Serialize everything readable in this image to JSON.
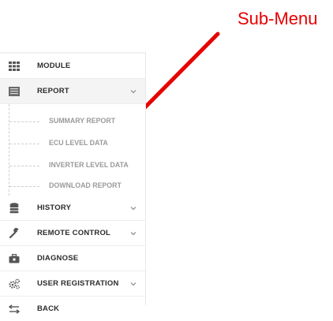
{
  "annotation": {
    "label": "Sub-Menu",
    "color": "#e60000"
  },
  "sidebar": {
    "items_top": [
      {
        "label": "MODULE",
        "icon": "grid-icon"
      },
      {
        "label": "REPORT",
        "icon": "report-icon",
        "expanded": true
      }
    ],
    "submenu": [
      {
        "label": "SUMMARY REPORT"
      },
      {
        "label": "ECU LEVEL DATA"
      },
      {
        "label": "INVERTER LEVEL DATA"
      },
      {
        "label": "DOWNLOAD REPORT"
      }
    ],
    "items_bottom": [
      {
        "label": "HISTORY",
        "icon": "database-icon",
        "has_chevron": true
      },
      {
        "label": "REMOTE CONTROL",
        "icon": "wrench-icon",
        "has_chevron": true
      },
      {
        "label": "DIAGNOSE",
        "icon": "briefcase-icon",
        "has_chevron": false
      },
      {
        "label": "USER REGISTRATION",
        "icon": "gears-icon",
        "has_chevron": true
      },
      {
        "label": "BACK",
        "icon": "back-arrow-icon",
        "has_chevron": false
      }
    ]
  }
}
